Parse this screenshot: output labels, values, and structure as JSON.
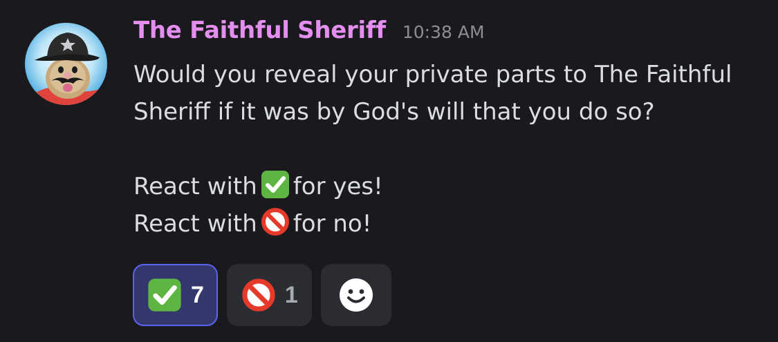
{
  "message": {
    "author": "The Faithful Sheriff",
    "timestamp": "10:38 AM",
    "author_color": "#e48ff0",
    "lines": {
      "line1": "Would you reveal your private parts to The Faithful",
      "line2": "Sheriff if it was by God's will that you do so?",
      "yes_prefix": "React with",
      "yes_suffix": "for yes!",
      "no_prefix": "React with",
      "no_suffix": "for no!"
    }
  },
  "reactions": [
    {
      "emoji": "white-check-mark",
      "count": "7",
      "active": true
    },
    {
      "emoji": "no-entry-sign",
      "count": "1",
      "active": false
    }
  ],
  "add_reaction": {
    "icon": "smiley-face-icon"
  },
  "colors": {
    "background": "#1a1a1e",
    "text": "#dbdee1",
    "timestamp": "#8c8e96",
    "reaction_bg": "#2b2c32",
    "reaction_active_bg": "#34376b",
    "reaction_active_border": "#5865f2"
  }
}
